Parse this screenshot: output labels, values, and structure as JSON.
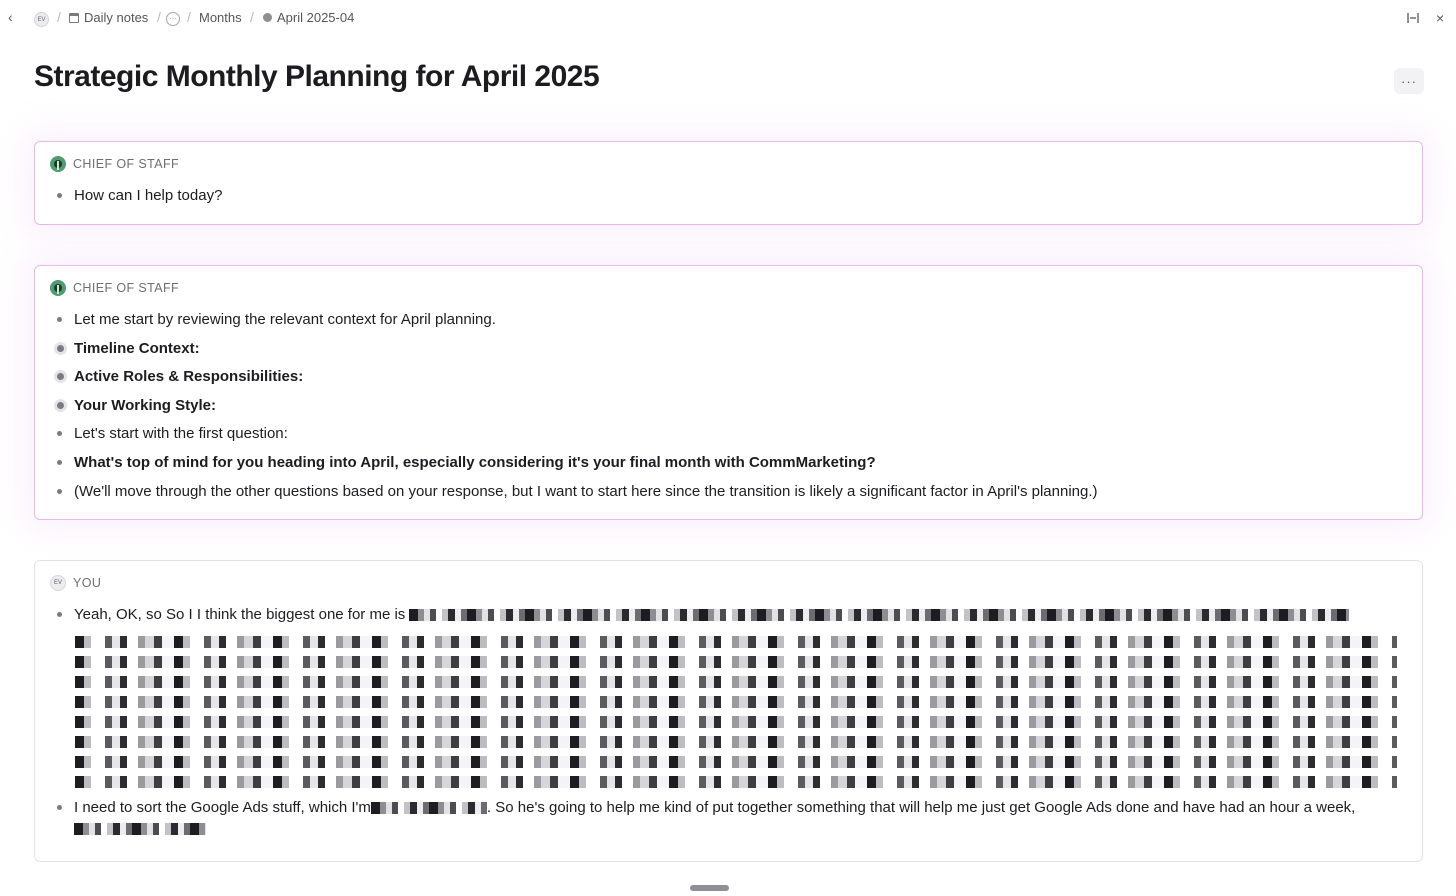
{
  "breadcrumb": {
    "avatar": "EV",
    "daily_notes": "Daily notes",
    "ellipsis": "···",
    "months": "Months",
    "current": "April 2025-04"
  },
  "icons": {
    "back": "chevron-left-icon",
    "collapse": "collapse-panel-icon",
    "close": "close-icon"
  },
  "page": {
    "title": "Strategic Monthly Planning for April 2025",
    "more_label": "···"
  },
  "cards": [
    {
      "author": "CHIEF OF STAFF",
      "items": [
        {
          "text": "How can I help today?",
          "bold": false
        }
      ]
    },
    {
      "author": "CHIEF OF STAFF",
      "items": [
        {
          "text": "Let me start by reviewing the relevant context for April planning.",
          "bold": false
        },
        {
          "text": "Timeline Context:",
          "bold": true,
          "collapsed": true
        },
        {
          "text": "Active Roles & Responsibilities:",
          "bold": true,
          "collapsed": true
        },
        {
          "text": "Your Working Style:",
          "bold": true,
          "collapsed": true
        },
        {
          "text": "Let's start with the first question:",
          "bold": false
        },
        {
          "text": "What's top of mind for you heading into April, especially considering it's your final month with CommMarketing?",
          "bold": true
        },
        {
          "text": "(We'll move through the other questions based on your response, but I want to start here since the transition is likely a significant factor in April's planning.)",
          "bold": false
        }
      ]
    },
    {
      "author": "YOU",
      "avatar": "EV",
      "items": [
        {
          "text": "Yeah, OK, so So I I think the biggest one for me is",
          "redacted": true
        },
        {
          "text_a": "I need to sort the Google Ads stuff, which I'm",
          "text_b": ". So he's going to help me kind of put together something that will help me just get Google Ads done and have had an hour a week,",
          "redacted": true
        }
      ]
    }
  ]
}
